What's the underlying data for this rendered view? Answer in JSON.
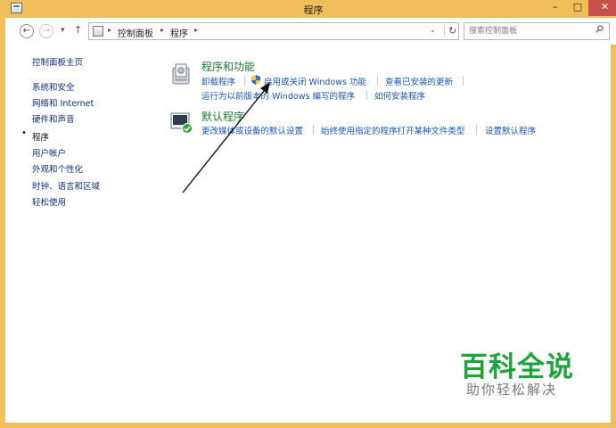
{
  "window": {
    "title": "程序"
  },
  "address": {
    "crumbs": [
      "控制面板",
      "程序"
    ],
    "search_placeholder": "搜索控制面板"
  },
  "sidebar": {
    "items": [
      {
        "label": "控制面板主页",
        "active": false
      },
      {
        "label": "系统和安全",
        "active": false
      },
      {
        "label": "网络和 Internet",
        "active": false
      },
      {
        "label": "硬件和声音",
        "active": false
      },
      {
        "label": "程序",
        "active": true
      },
      {
        "label": "用户帐户",
        "active": false
      },
      {
        "label": "外观和个性化",
        "active": false
      },
      {
        "label": "时钟、语言和区域",
        "active": false
      },
      {
        "label": "轻松使用",
        "active": false
      }
    ]
  },
  "categories": {
    "programs_features": {
      "title": "程序和功能",
      "links": [
        "卸载程序",
        "启用或关闭 Windows 功能",
        "查看已安装的更新",
        "运行为以前版本的 Windows 编写的程序",
        "如何安装程序"
      ]
    },
    "default_programs": {
      "title": "默认程序",
      "links": [
        "更改媒体或设备的默认设置",
        "始终使用指定的程序打开某种文件类型",
        "设置默认程序"
      ]
    }
  },
  "watermark": {
    "main": "百科全说",
    "sub": "助你轻松解决"
  },
  "colors": {
    "titlebar": "#f0bf5a",
    "link": "#1a56b4",
    "category_title": "#1f7a2e",
    "close": "#c7504b"
  }
}
